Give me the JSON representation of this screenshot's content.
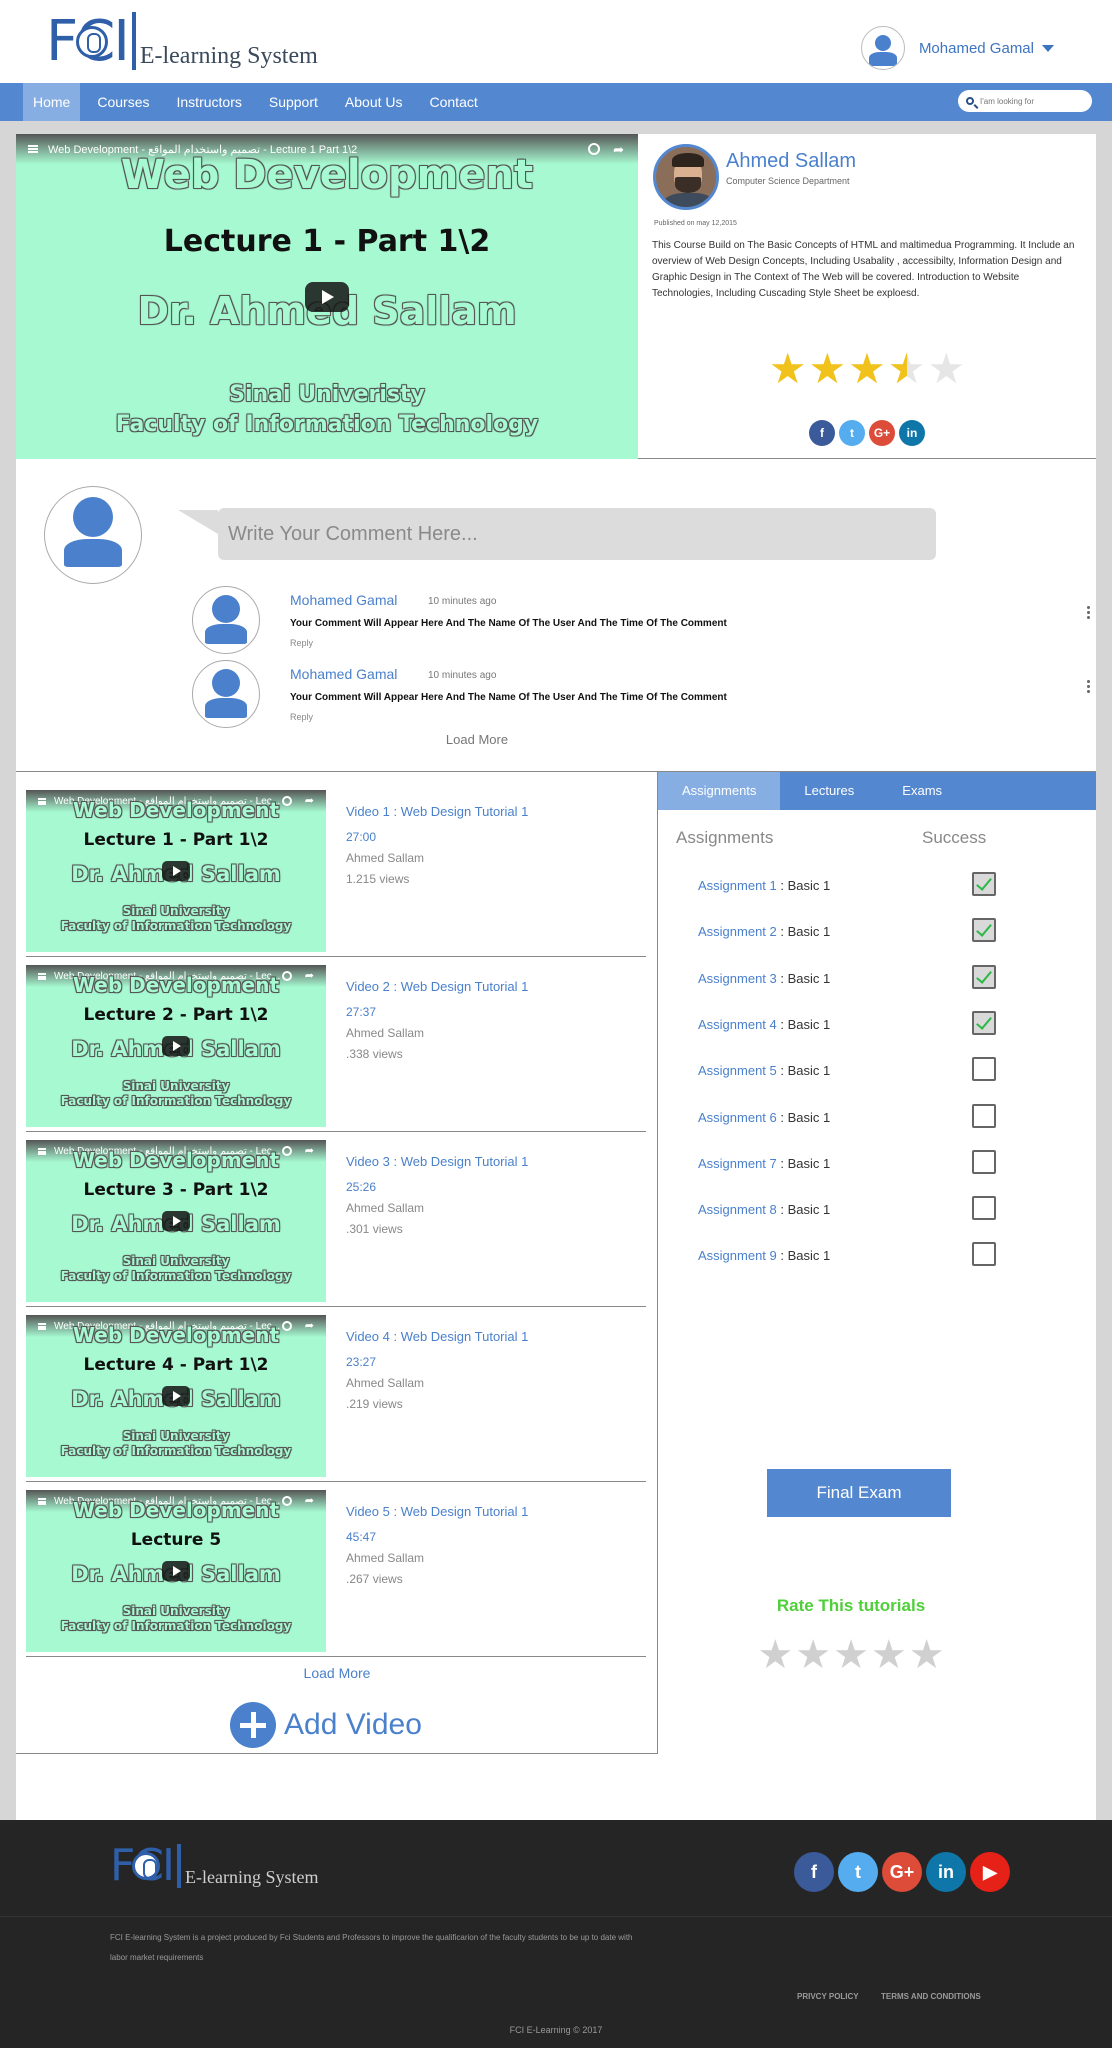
{
  "header": {
    "logo_letters": "FCI",
    "logo_text": "E-learning System",
    "user_name": "Mohamed Gamal"
  },
  "nav": {
    "items": [
      "Home",
      "Courses",
      "Instructors",
      "Support",
      "About Us",
      "Contact"
    ],
    "active": "Home",
    "search_placeholder": "I'am looking for"
  },
  "player": {
    "title": "Web Development - تصميم واستخدام المواقع - Lecture 1 Part 1\\2",
    "lines": [
      "Web Development",
      "Lecture 1 - Part 1\\2",
      "Dr. Ahmed Sallam",
      "Sinai Univeristy",
      "Faculty of Information Technology"
    ]
  },
  "instructor": {
    "name": "Ahmed Sallam",
    "department": "Computer Science Department",
    "published": "Published on may 12,2015",
    "description": "This Course Build on The Basic Concepts of HTML and maltimedua Programming. It Include an overview of Web Design Concepts, Including Usabality , accessibilty, Information Design and Graphic Design in The Context of The Web will be covered. Introduction to Website Technologies, Including Cuscading Style Sheet be exploesd.",
    "rating": 3.5,
    "rating_max": 5,
    "socials": [
      "f",
      "t",
      "G+",
      "in"
    ]
  },
  "comments": {
    "placeholder": "Write Your Comment Here...",
    "items": [
      {
        "user": "Mohamed Gamal",
        "time": "10 minutes ago",
        "text": "Your Comment Will Appear Here And The Name Of The User And The Time Of The Comment",
        "reply": "Reply"
      },
      {
        "user": "Mohamed Gamal",
        "time": "10 minutes ago",
        "text": "Your Comment Will Appear Here And The Name Of The User And The Time Of The Comment",
        "reply": "Reply"
      }
    ],
    "load_more": "Load More"
  },
  "videos": {
    "items": [
      {
        "thumb_title": "Web Development - تصميم واستخدام المواقع - Lec...",
        "thumb_lecture": "Lecture 1 - Part 1\\2",
        "title": "Video 1 : Web Design Tutorial 1",
        "duration": "27:00",
        "author": "Ahmed Sallam",
        "views": "1.215 views"
      },
      {
        "thumb_title": "Web Development - تصميم واستخدام المواقع - Lec...",
        "thumb_lecture": "Lecture 2 - Part 1\\2",
        "title": "Video 2 : Web Design Tutorial 1",
        "duration": "27:37",
        "author": "Ahmed Sallam",
        "views": ".338 views"
      },
      {
        "thumb_title": "Web Development - تصميم واستخدام المواقع - Lec...",
        "thumb_lecture": "Lecture 3 - Part 1\\2",
        "title": "Video 3 : Web Design Tutorial 1",
        "duration": "25:26",
        "author": "Ahmed Sallam",
        "views": ".301 views"
      },
      {
        "thumb_title": "Web Development - تصميم واستخدام المواقع - Lec...",
        "thumb_lecture": "Lecture 4 - Part 1\\2",
        "title": "Video 4 : Web Design Tutorial 1",
        "duration": "23:27",
        "author": "Ahmed Sallam",
        "views": ".219 views"
      },
      {
        "thumb_title": "Web Development - تصميم واستخدام المواقع - Lec...",
        "thumb_lecture": "Lecture 5",
        "title": "Video 5 : Web Design Tutorial 1",
        "duration": "45:47",
        "author": "Ahmed Sallam",
        "views": ".267 views"
      }
    ],
    "thumb_lines": [
      "Web Development",
      "Dr. Ahmed Sallam",
      "Sinai University",
      "Faculty of Information Technology"
    ],
    "load_more": "Load More",
    "add_label": "Add Video"
  },
  "tabs": {
    "items": [
      "Assignments",
      "Lectures",
      "Exams"
    ],
    "active": "Assignments",
    "col_assignments": "Assignments",
    "col_success": "Success",
    "assignments": [
      {
        "name": "Assignment 1",
        "topic": " : Basic 1",
        "done": true
      },
      {
        "name": "Assignment 2",
        "topic": " : Basic 1",
        "done": true
      },
      {
        "name": "Assignment 3",
        "topic": " : Basic 1",
        "done": true
      },
      {
        "name": "Assignment 4",
        "topic": " : Basic 1",
        "done": true
      },
      {
        "name": "Assignment 5",
        "topic": " : Basic 1",
        "done": false
      },
      {
        "name": "Assignment 6",
        "topic": " : Basic 1",
        "done": false
      },
      {
        "name": "Assignment 7",
        "topic": " : Basic 1",
        "done": false
      },
      {
        "name": "Assignment 8",
        "topic": " : Basic 1",
        "done": false
      },
      {
        "name": "Assignment 9",
        "topic": " : Basic 1",
        "done": false
      }
    ],
    "final_exam": "Final Exam",
    "rate_label": "Rate This tutorials",
    "rate_value": 0,
    "rate_max": 5
  },
  "footer": {
    "logo_letters": "FCI",
    "logo_text": "E-learning System",
    "socials": [
      "f",
      "t",
      "G+",
      "in",
      "▶"
    ],
    "about": "FCI E-learning System is a project produced by Fci Students and Professors to improve the qualificarion of the faculty students to be up to date with labor market requirements",
    "privacy": "PRIVCY POLICY",
    "terms": "TERMS AND CONDITIONS",
    "copyright": "FCI E-Learning © 2017"
  },
  "colors": {
    "brand_blue": "#5388d0",
    "link_blue": "#4a80cc",
    "star_gold": "#f2c21c",
    "success_green": "#4fcf3a",
    "video_bg": "#a6f9d1",
    "footer_bg": "#252525"
  }
}
